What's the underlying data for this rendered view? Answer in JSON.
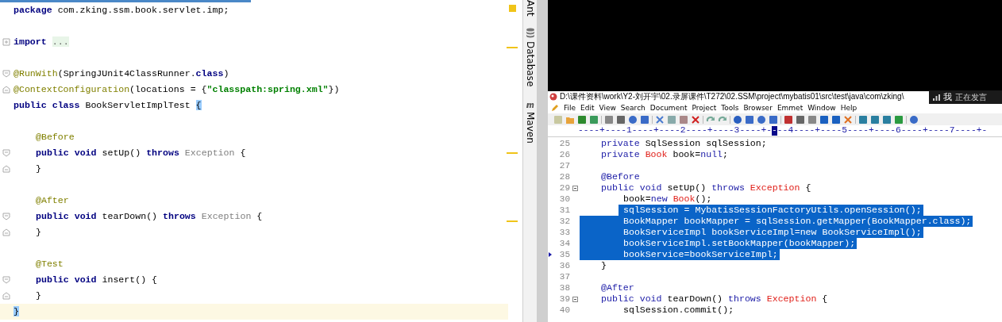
{
  "ide_editor": {
    "lines": [
      {
        "kind": "plain",
        "tokens": [
          {
            "kind": "keyword",
            "text": "package"
          },
          {
            "kind": "plain",
            "text": " com.zking.ssm.book.servlet.imp;"
          }
        ]
      },
      {
        "kind": "plain"
      },
      {
        "kind": "collapsed",
        "tokens": [
          {
            "kind": "keyword",
            "text": "import"
          },
          {
            "kind": "folded",
            "text": "..."
          }
        ]
      },
      {
        "kind": "plain"
      },
      {
        "kind": "fold_start",
        "tokens": [
          {
            "kind": "annotation",
            "text": "@RunWith"
          },
          {
            "kind": "plain",
            "text": "(SpringJUnit4ClassRunner."
          },
          {
            "kind": "keyword",
            "text": "class"
          },
          {
            "kind": "plain",
            "text": ")"
          }
        ]
      },
      {
        "kind": "fold_end",
        "tokens": [
          {
            "kind": "annotation",
            "text": "@ContextConfiguration"
          },
          {
            "kind": "plain",
            "text": "(locations = {"
          },
          {
            "kind": "string",
            "text": "\"classpath:spring.xml\""
          },
          {
            "kind": "plain",
            "text": "})"
          }
        ]
      },
      {
        "kind": "plain",
        "tokens": [
          {
            "kind": "keyword",
            "text": "public class"
          },
          {
            "kind": "plain",
            "text": " BookServletImplTest "
          },
          {
            "kind": "brace",
            "text": "{"
          }
        ]
      },
      {
        "kind": "plain"
      },
      {
        "kind": "plain",
        "indented": true,
        "tokens": [
          {
            "kind": "annotation",
            "text": "@Before"
          }
        ]
      },
      {
        "kind": "fold_start",
        "indented": true,
        "tokens": [
          {
            "kind": "keyword",
            "text": "public void"
          },
          {
            "kind": "plain",
            "text": " setUp() "
          },
          {
            "kind": "keyword",
            "text": "throws"
          },
          {
            "kind": "dim",
            "text": " Exception"
          },
          {
            "kind": "plain",
            "text": " {"
          }
        ]
      },
      {
        "kind": "fold_end",
        "indented": true,
        "tokens": [
          {
            "kind": "plain",
            "text": "}"
          }
        ]
      },
      {
        "kind": "plain"
      },
      {
        "kind": "plain",
        "indented": true,
        "tokens": [
          {
            "kind": "annotation",
            "text": "@After"
          }
        ]
      },
      {
        "kind": "fold_start",
        "indented": true,
        "tokens": [
          {
            "kind": "keyword",
            "text": "public void"
          },
          {
            "kind": "plain",
            "text": " tearDown() "
          },
          {
            "kind": "keyword",
            "text": "throws"
          },
          {
            "kind": "dim",
            "text": " Exception"
          },
          {
            "kind": "plain",
            "text": " {"
          }
        ]
      },
      {
        "kind": "fold_end",
        "indented": true,
        "tokens": [
          {
            "kind": "plain",
            "text": "}"
          }
        ]
      },
      {
        "kind": "plain"
      },
      {
        "kind": "plain",
        "indented": true,
        "tokens": [
          {
            "kind": "annotation",
            "text": "@Test"
          }
        ]
      },
      {
        "kind": "fold_start",
        "indented": true,
        "tokens": [
          {
            "kind": "keyword",
            "text": "public void"
          },
          {
            "kind": "plain",
            "text": " insert() {"
          }
        ]
      },
      {
        "kind": "fold_end",
        "indented": true,
        "tokens": [
          {
            "kind": "plain",
            "text": "}"
          }
        ]
      },
      {
        "kind": "plain",
        "current": true,
        "tokens": [
          {
            "kind": "brace",
            "text": "}"
          }
        ]
      }
    ]
  },
  "tool_strip": [
    {
      "kind": "text",
      "label": "Ant"
    },
    {
      "kind": "database",
      "label": "Database"
    },
    {
      "kind": "maven",
      "label": "Maven"
    }
  ],
  "text_editor": {
    "title": "D:\\课件资料\\work\\Y2-刘开宇\\02.录屏课件\\T272\\02.SSM\\project\\mybatis01\\src\\test\\java\\com\\zking\\",
    "menu": [
      "File",
      "Edit",
      "View",
      "Search",
      "Document",
      "Project",
      "Tools",
      "Browser",
      "Emmet",
      "Window",
      "Help"
    ],
    "ruler": {
      "before": "----+----1----+----2----+----3----+-",
      "cursor": "-",
      "after": "--4----+----5----+----6----+----7----+-"
    },
    "speaker_overlay": {
      "name": "我",
      "status": "正在发言"
    },
    "lines": [
      {
        "number": "25",
        "kind": "plain",
        "selected": false,
        "indented": true,
        "tokens": [
          {
            "kind": "keyword",
            "text": "private"
          },
          {
            "kind": "plain",
            "text": " SqlSession sqlSession;"
          }
        ]
      },
      {
        "number": "26",
        "kind": "plain",
        "selected": false,
        "indented": true,
        "tokens": [
          {
            "kind": "keyword",
            "text": "private"
          },
          {
            "kind": "type",
            "text": " Book"
          },
          {
            "kind": "plain",
            "text": " book="
          },
          {
            "kind": "keyword",
            "text": "null"
          },
          {
            "kind": "plain",
            "text": ";"
          }
        ]
      },
      {
        "number": "27",
        "kind": "plain"
      },
      {
        "number": "28",
        "kind": "plain",
        "selected": false,
        "indented": true,
        "tokens": [
          {
            "kind": "keyword",
            "text": "@Before"
          }
        ]
      },
      {
        "number": "29",
        "kind": "fold",
        "selected": false,
        "indented": true,
        "tokens": [
          {
            "kind": "keyword",
            "text": "public void"
          },
          {
            "kind": "plain",
            "text": " setUp() "
          },
          {
            "kind": "keyword",
            "text": "throws"
          },
          {
            "kind": "type",
            "text": " Exception"
          },
          {
            "kind": "plain",
            "text": " {"
          }
        ]
      },
      {
        "number": "30",
        "kind": "plain",
        "selected": false,
        "indented": true,
        "nested": true,
        "tokens": [
          {
            "kind": "plain",
            "text": "book="
          },
          {
            "kind": "keyword",
            "text": "new"
          },
          {
            "kind": "type",
            "text": " Book"
          },
          {
            "kind": "plain",
            "text": "();"
          }
        ]
      },
      {
        "number": "31",
        "kind": "plain",
        "selected": true,
        "indented": true,
        "nested": true,
        "code": "sqlSession = MybatisSessionFactoryUtils.openSession();"
      },
      {
        "number": "32",
        "kind": "plain",
        "selected": true,
        "indented": true,
        "nested": true,
        "code": "BookMapper bookMapper = sqlSession.getMapper(BookMapper.class);"
      },
      {
        "number": "33",
        "kind": "plain",
        "selected": true,
        "indented": true,
        "nested": true,
        "code": "BookServiceImpl bookServiceImpl=new BookServiceImpl();"
      },
      {
        "number": "34",
        "kind": "plain",
        "selected": true,
        "indented": true,
        "nested": true,
        "code": "bookServiceImpl.setBookMapper(bookMapper);"
      },
      {
        "number": "35",
        "kind": "plain",
        "selected": true,
        "caret": true,
        "indented": true,
        "nested": true,
        "code": "bookService=bookServiceImpl;"
      },
      {
        "number": "36",
        "kind": "plain",
        "selected": false,
        "indented": true,
        "tokens": [
          {
            "kind": "plain",
            "text": "}"
          }
        ]
      },
      {
        "number": "37",
        "kind": "plain"
      },
      {
        "number": "38",
        "kind": "plain",
        "selected": false,
        "indented": true,
        "tokens": [
          {
            "kind": "keyword",
            "text": "@After"
          }
        ]
      },
      {
        "number": "39",
        "kind": "fold",
        "selected": false,
        "indented": true,
        "tokens": [
          {
            "kind": "keyword",
            "text": "public void"
          },
          {
            "kind": "plain",
            "text": " tearDown() "
          },
          {
            "kind": "keyword",
            "text": "throws"
          },
          {
            "kind": "type",
            "text": " Exception"
          },
          {
            "kind": "plain",
            "text": " {"
          }
        ]
      },
      {
        "number": "40",
        "kind": "plain",
        "selected": false,
        "indented": true,
        "nested": true,
        "tokens": [
          {
            "kind": "plain",
            "text": "sqlSession.commit();"
          }
        ]
      }
    ]
  }
}
